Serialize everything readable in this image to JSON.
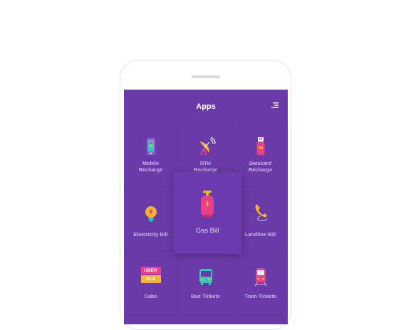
{
  "header": {
    "title": "Apps",
    "menu_icon": "menu-icon"
  },
  "apps": [
    {
      "name": "mobile-recharge",
      "line1": "Mobile",
      "line2": "Recharge",
      "icon": "mobile-phone-icon"
    },
    {
      "name": "dth-recharge",
      "line1": "DTH",
      "line2": "Recharge",
      "icon": "satellite-dish-icon"
    },
    {
      "name": "datacard-recharge",
      "line1": "Datacard",
      "line2": "Recharge",
      "icon": "usb-datacard-icon"
    },
    {
      "name": "electricity-bill",
      "line1": "Electricity Bill",
      "line2": "",
      "icon": "lightbulb-icon"
    },
    {
      "name": "gas-bill",
      "line1": "Gas Bill",
      "line2": "",
      "icon": "gas-cylinder-icon",
      "highlighted": true
    },
    {
      "name": "landline-bill",
      "line1": "Landline Bill",
      "line2": "",
      "icon": "telephone-icon"
    },
    {
      "name": "cabs",
      "line1": "Cabs",
      "line2": "",
      "icon": "cabs-icon",
      "badges": [
        "UBER",
        "OLA"
      ]
    },
    {
      "name": "bus-tickets",
      "line1": "Bus Tickets",
      "line2": "",
      "icon": "bus-icon"
    },
    {
      "name": "train-tickets",
      "line1": "Train Tickets",
      "line2": "",
      "icon": "train-icon"
    }
  ],
  "colors": {
    "screen_bg": "#6a3aa8",
    "label": "#c9b4ea",
    "pink": "#e8418c",
    "yellow": "#f6b427",
    "teal": "#35c6c3"
  }
}
